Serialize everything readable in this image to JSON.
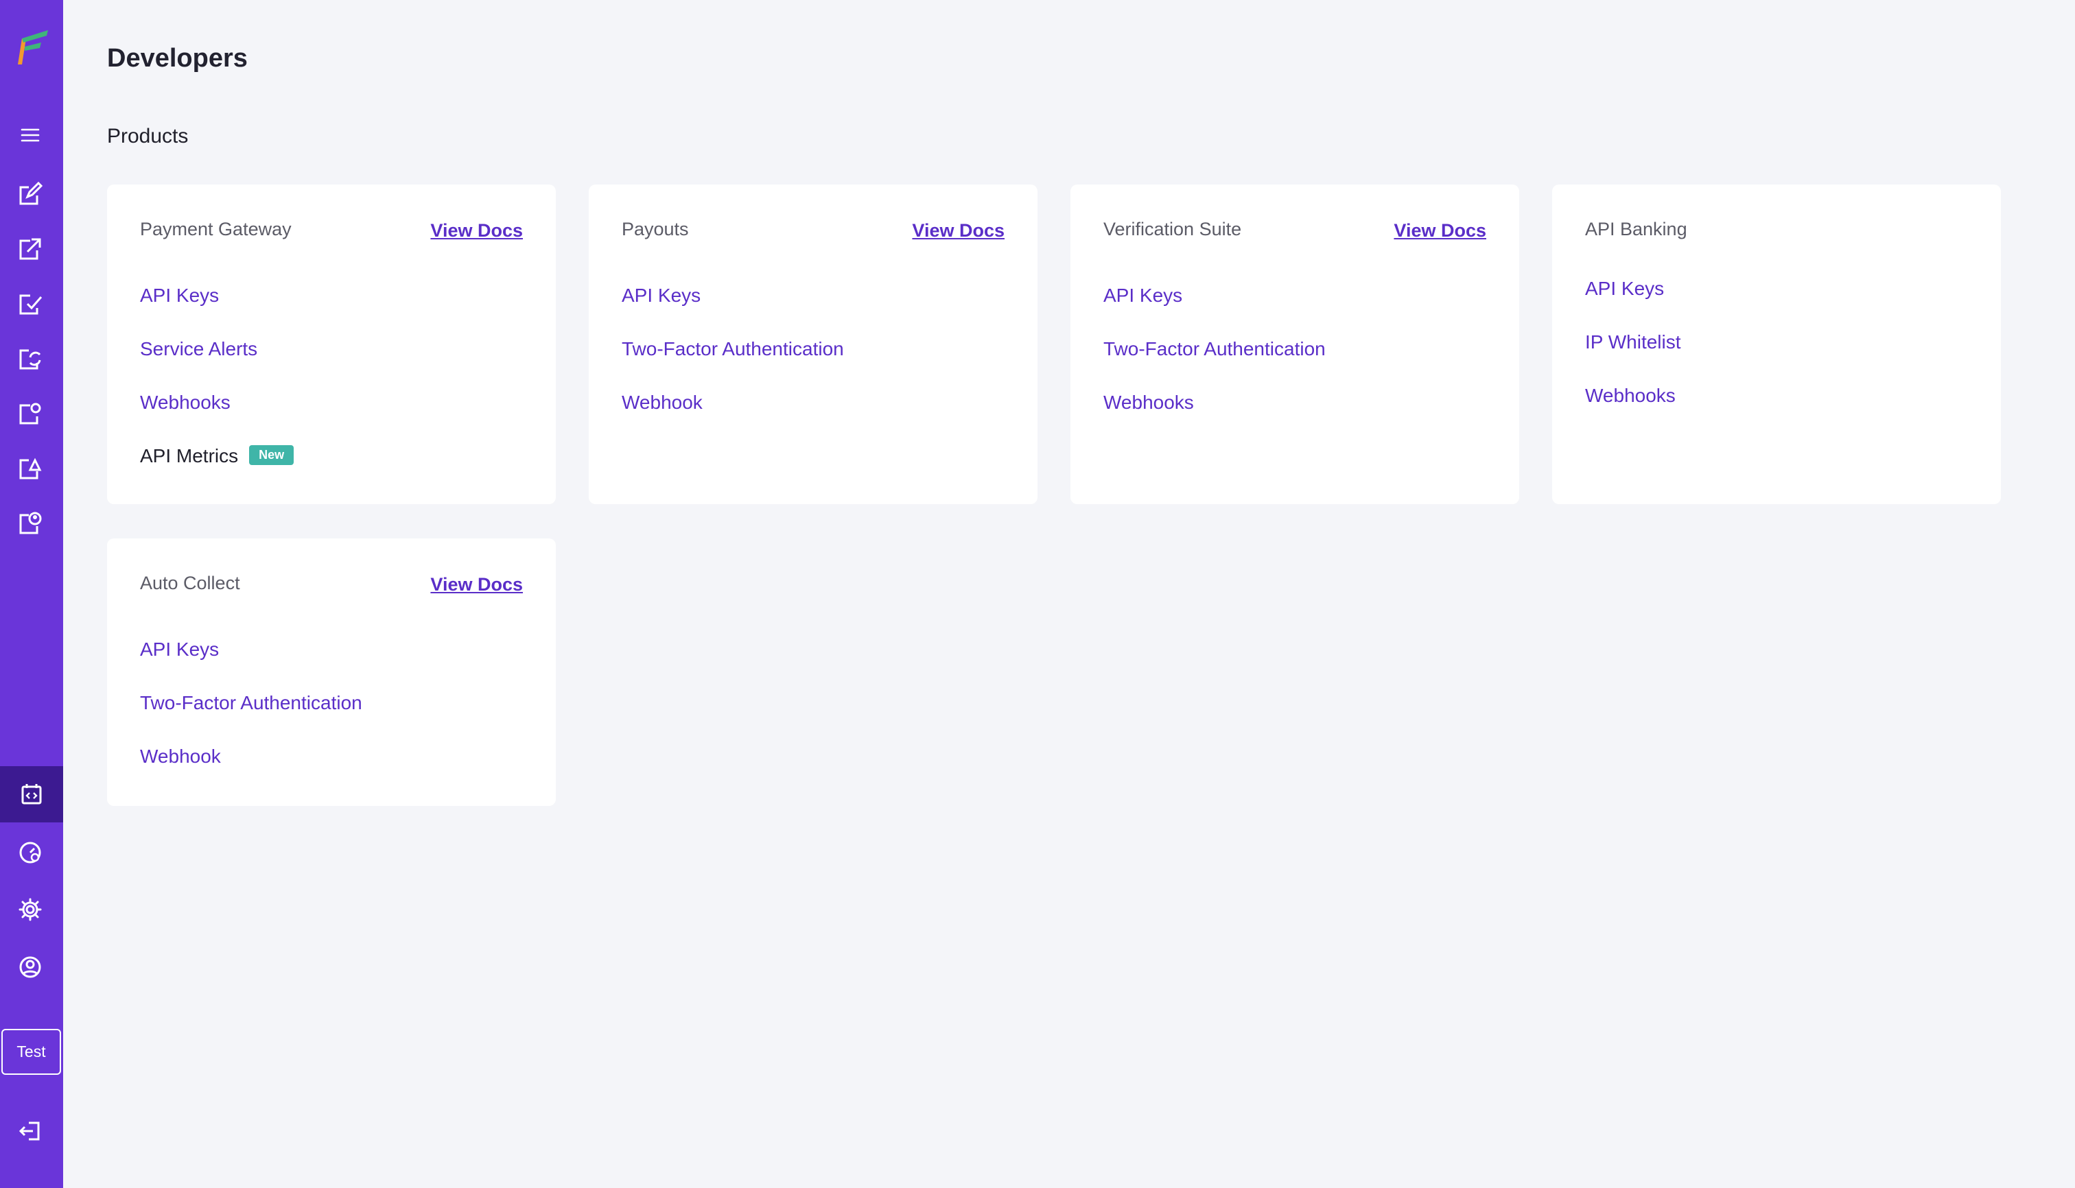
{
  "page": {
    "title": "Developers",
    "section": "Products"
  },
  "sidebar": {
    "icons": [
      "menu-icon",
      "edit-doc-icon",
      "export-doc-icon",
      "verified-doc-icon",
      "refresh-doc-icon",
      "profile-doc-icon",
      "upload-doc-icon",
      "user-doc-icon"
    ],
    "active": "developers-code-icon",
    "bottom_icons": [
      "dashboard-gauge-icon",
      "settings-gear-icon",
      "account-user-icon",
      "logout-icon"
    ],
    "mode_label": "Test"
  },
  "cards": [
    {
      "title": "Payment Gateway",
      "docs": "View Docs",
      "links": [
        "API Keys",
        "Service Alerts",
        "Webhooks"
      ],
      "extra_link": "API Metrics",
      "extra_badge": "New"
    },
    {
      "title": "Payouts",
      "docs": "View Docs",
      "links": [
        "API Keys",
        "Two-Factor Authentication",
        "Webhook"
      ]
    },
    {
      "title": "Verification Suite",
      "docs": "View Docs",
      "links": [
        "API Keys",
        "Two-Factor Authentication",
        "Webhooks"
      ]
    },
    {
      "title": "API Banking",
      "links": [
        "API Keys",
        "IP Whitelist",
        "Webhooks"
      ]
    },
    {
      "title": "Auto Collect",
      "docs": "View Docs",
      "links": [
        "API Keys",
        "Two-Factor Authentication",
        "Webhook"
      ]
    }
  ],
  "colors": {
    "sidebar": "#6a35d9",
    "sidebar_active": "#3c1a91",
    "link": "#5a2ec8",
    "badge": "#3fb5a8",
    "background": "#f4f5f9"
  }
}
